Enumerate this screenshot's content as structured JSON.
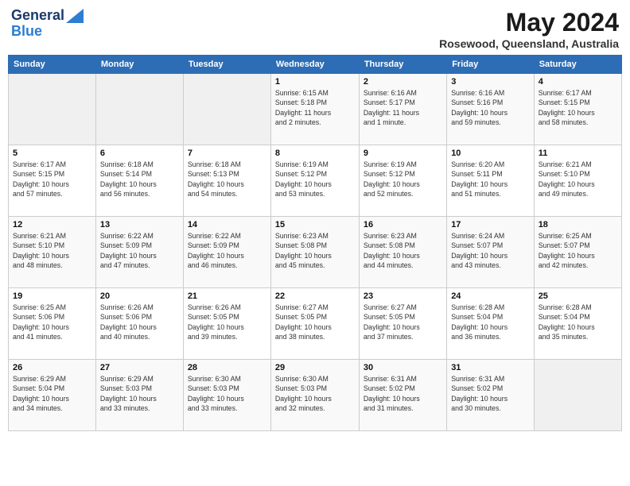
{
  "header": {
    "logo_line1": "General",
    "logo_line2": "Blue",
    "month": "May 2024",
    "location": "Rosewood, Queensland, Australia"
  },
  "weekdays": [
    "Sunday",
    "Monday",
    "Tuesday",
    "Wednesday",
    "Thursday",
    "Friday",
    "Saturday"
  ],
  "weeks": [
    [
      {
        "day": "",
        "info": ""
      },
      {
        "day": "",
        "info": ""
      },
      {
        "day": "",
        "info": ""
      },
      {
        "day": "1",
        "info": "Sunrise: 6:15 AM\nSunset: 5:18 PM\nDaylight: 11 hours\nand 2 minutes."
      },
      {
        "day": "2",
        "info": "Sunrise: 6:16 AM\nSunset: 5:17 PM\nDaylight: 11 hours\nand 1 minute."
      },
      {
        "day": "3",
        "info": "Sunrise: 6:16 AM\nSunset: 5:16 PM\nDaylight: 10 hours\nand 59 minutes."
      },
      {
        "day": "4",
        "info": "Sunrise: 6:17 AM\nSunset: 5:15 PM\nDaylight: 10 hours\nand 58 minutes."
      }
    ],
    [
      {
        "day": "5",
        "info": "Sunrise: 6:17 AM\nSunset: 5:15 PM\nDaylight: 10 hours\nand 57 minutes."
      },
      {
        "day": "6",
        "info": "Sunrise: 6:18 AM\nSunset: 5:14 PM\nDaylight: 10 hours\nand 56 minutes."
      },
      {
        "day": "7",
        "info": "Sunrise: 6:18 AM\nSunset: 5:13 PM\nDaylight: 10 hours\nand 54 minutes."
      },
      {
        "day": "8",
        "info": "Sunrise: 6:19 AM\nSunset: 5:12 PM\nDaylight: 10 hours\nand 53 minutes."
      },
      {
        "day": "9",
        "info": "Sunrise: 6:19 AM\nSunset: 5:12 PM\nDaylight: 10 hours\nand 52 minutes."
      },
      {
        "day": "10",
        "info": "Sunrise: 6:20 AM\nSunset: 5:11 PM\nDaylight: 10 hours\nand 51 minutes."
      },
      {
        "day": "11",
        "info": "Sunrise: 6:21 AM\nSunset: 5:10 PM\nDaylight: 10 hours\nand 49 minutes."
      }
    ],
    [
      {
        "day": "12",
        "info": "Sunrise: 6:21 AM\nSunset: 5:10 PM\nDaylight: 10 hours\nand 48 minutes."
      },
      {
        "day": "13",
        "info": "Sunrise: 6:22 AM\nSunset: 5:09 PM\nDaylight: 10 hours\nand 47 minutes."
      },
      {
        "day": "14",
        "info": "Sunrise: 6:22 AM\nSunset: 5:09 PM\nDaylight: 10 hours\nand 46 minutes."
      },
      {
        "day": "15",
        "info": "Sunrise: 6:23 AM\nSunset: 5:08 PM\nDaylight: 10 hours\nand 45 minutes."
      },
      {
        "day": "16",
        "info": "Sunrise: 6:23 AM\nSunset: 5:08 PM\nDaylight: 10 hours\nand 44 minutes."
      },
      {
        "day": "17",
        "info": "Sunrise: 6:24 AM\nSunset: 5:07 PM\nDaylight: 10 hours\nand 43 minutes."
      },
      {
        "day": "18",
        "info": "Sunrise: 6:25 AM\nSunset: 5:07 PM\nDaylight: 10 hours\nand 42 minutes."
      }
    ],
    [
      {
        "day": "19",
        "info": "Sunrise: 6:25 AM\nSunset: 5:06 PM\nDaylight: 10 hours\nand 41 minutes."
      },
      {
        "day": "20",
        "info": "Sunrise: 6:26 AM\nSunset: 5:06 PM\nDaylight: 10 hours\nand 40 minutes."
      },
      {
        "day": "21",
        "info": "Sunrise: 6:26 AM\nSunset: 5:05 PM\nDaylight: 10 hours\nand 39 minutes."
      },
      {
        "day": "22",
        "info": "Sunrise: 6:27 AM\nSunset: 5:05 PM\nDaylight: 10 hours\nand 38 minutes."
      },
      {
        "day": "23",
        "info": "Sunrise: 6:27 AM\nSunset: 5:05 PM\nDaylight: 10 hours\nand 37 minutes."
      },
      {
        "day": "24",
        "info": "Sunrise: 6:28 AM\nSunset: 5:04 PM\nDaylight: 10 hours\nand 36 minutes."
      },
      {
        "day": "25",
        "info": "Sunrise: 6:28 AM\nSunset: 5:04 PM\nDaylight: 10 hours\nand 35 minutes."
      }
    ],
    [
      {
        "day": "26",
        "info": "Sunrise: 6:29 AM\nSunset: 5:04 PM\nDaylight: 10 hours\nand 34 minutes."
      },
      {
        "day": "27",
        "info": "Sunrise: 6:29 AM\nSunset: 5:03 PM\nDaylight: 10 hours\nand 33 minutes."
      },
      {
        "day": "28",
        "info": "Sunrise: 6:30 AM\nSunset: 5:03 PM\nDaylight: 10 hours\nand 33 minutes."
      },
      {
        "day": "29",
        "info": "Sunrise: 6:30 AM\nSunset: 5:03 PM\nDaylight: 10 hours\nand 32 minutes."
      },
      {
        "day": "30",
        "info": "Sunrise: 6:31 AM\nSunset: 5:02 PM\nDaylight: 10 hours\nand 31 minutes."
      },
      {
        "day": "31",
        "info": "Sunrise: 6:31 AM\nSunset: 5:02 PM\nDaylight: 10 hours\nand 30 minutes."
      },
      {
        "day": "",
        "info": ""
      }
    ]
  ]
}
